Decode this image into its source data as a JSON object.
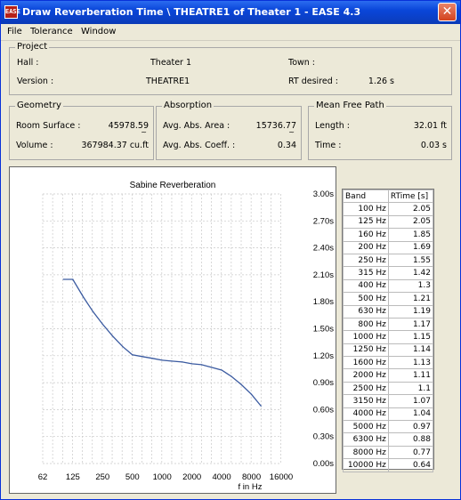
{
  "window": {
    "title": "Draw Reverberation Time \\ THEATRE1 of Theater 1 - EASE 4.3",
    "icon_text": "EASE",
    "close_glyph": "✕"
  },
  "menu": [
    "File",
    "Tolerance",
    "Window"
  ],
  "project": {
    "legend": "Project",
    "hall_label": "Hall :",
    "hall_value": "Theater 1",
    "town_label": "Town :",
    "town_value": "",
    "version_label": "Version :",
    "version_value": "THEATRE1",
    "rt_desired_label": "RT desired :",
    "rt_desired_value": "1.26 s"
  },
  "geometry": {
    "legend": "Geometry",
    "room_surface_label": "Room Surface :",
    "room_surface_value": "45978.59",
    "room_surface_unit": "~",
    "volume_label": "Volume :",
    "volume_value": "367984.37 cu.ft"
  },
  "absorption": {
    "legend": "Absorption",
    "area_label": "Avg. Abs. Area :",
    "area_value": "15736.77",
    "area_unit": "~",
    "coeff_label": "Avg. Abs. Coeff. :",
    "coeff_value": "0.34"
  },
  "mean_free_path": {
    "legend": "Mean Free Path",
    "length_label": "Length :",
    "length_value": "32.01 ft",
    "time_label": "Time :",
    "time_value": "0.03 s"
  },
  "rt_table": {
    "headers": [
      "Band",
      "RTime [s]"
    ],
    "rows": [
      [
        "100 Hz",
        "2.05"
      ],
      [
        "125 Hz",
        "2.05"
      ],
      [
        "160 Hz",
        "1.85"
      ],
      [
        "200 Hz",
        "1.69"
      ],
      [
        "250 Hz",
        "1.55"
      ],
      [
        "315 Hz",
        "1.42"
      ],
      [
        "400 Hz",
        "1.3"
      ],
      [
        "500 Hz",
        "1.21"
      ],
      [
        "630 Hz",
        "1.19"
      ],
      [
        "800 Hz",
        "1.17"
      ],
      [
        "1000 Hz",
        "1.15"
      ],
      [
        "1250 Hz",
        "1.14"
      ],
      [
        "1600 Hz",
        "1.13"
      ],
      [
        "2000 Hz",
        "1.11"
      ],
      [
        "2500 Hz",
        "1.1"
      ],
      [
        "3150 Hz",
        "1.07"
      ],
      [
        "4000 Hz",
        "1.04"
      ],
      [
        "5000 Hz",
        "0.97"
      ],
      [
        "6300 Hz",
        "0.88"
      ],
      [
        "8000 Hz",
        "0.77"
      ],
      [
        "10000 Hz",
        "0.64"
      ]
    ]
  },
  "chart_data": {
    "type": "line",
    "title": "Sabine Reverberation",
    "xlabel": "f in Hz",
    "ylabel": "",
    "x_scale": "log",
    "xlim": [
      62,
      16000
    ],
    "x_ticks": [
      62,
      125,
      250,
      500,
      1000,
      2000,
      4000,
      8000,
      16000
    ],
    "x_tick_labels": [
      "62",
      "125",
      "250",
      "500",
      "1000",
      "2000",
      "4000",
      "8000",
      "16000"
    ],
    "ylim": [
      0,
      3
    ],
    "y_ticks": [
      0,
      0.3,
      0.6,
      0.9,
      1.2,
      1.5,
      1.8,
      2.1,
      2.4,
      2.7,
      3.0
    ],
    "y_tick_labels": [
      "0.00s",
      "0.30s",
      "0.60s",
      "0.90s",
      "1.20s",
      "1.50s",
      "1.80s",
      "2.10s",
      "2.40s",
      "2.70s",
      "3.00s"
    ],
    "grid": true,
    "line_color": "#3a5aa0",
    "series": [
      {
        "x": [
          100,
          125,
          160,
          200,
          250,
          315,
          400,
          500,
          630,
          800,
          1000,
          1250,
          1600,
          2000,
          2500,
          3150,
          4000,
          5000,
          6300,
          8000,
          10000
        ],
        "values": [
          2.05,
          2.05,
          1.85,
          1.69,
          1.55,
          1.42,
          1.3,
          1.21,
          1.19,
          1.17,
          1.15,
          1.14,
          1.13,
          1.11,
          1.1,
          1.07,
          1.04,
          0.97,
          0.88,
          0.77,
          0.64
        ]
      }
    ]
  }
}
